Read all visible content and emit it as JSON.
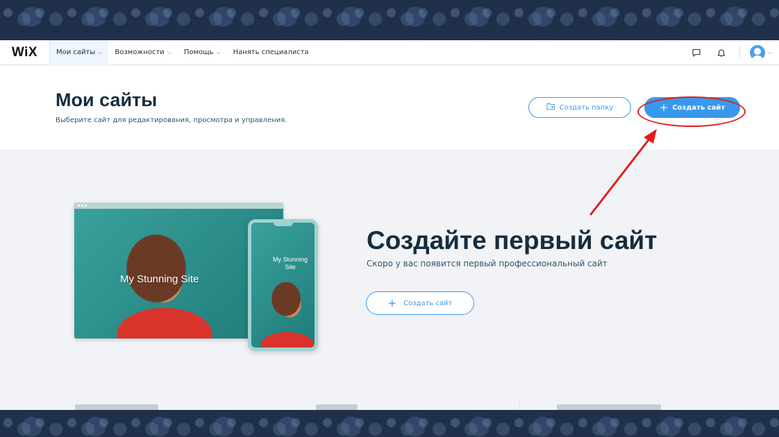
{
  "nav": {
    "logo": "WiX",
    "items": [
      {
        "label": "Мои сайты",
        "chevron": true,
        "active": true
      },
      {
        "label": "Возможности",
        "chevron": true
      },
      {
        "label": "Помощь",
        "chevron": true
      },
      {
        "label": "Нанять специалиста",
        "chevron": false
      }
    ],
    "icons": [
      "chat-icon",
      "bell-icon",
      "avatar",
      "chevron-down-icon"
    ]
  },
  "header": {
    "title": "Мои сайты",
    "subtitle": "Выберите сайт для редактирования, просмотра и управления.",
    "folder_button": "Создать папку",
    "create_button": "Создать сайт",
    "create_icon": "+"
  },
  "hero": {
    "mock_site_title": "My Stunning Site",
    "phone_title": "My Stunning Site",
    "title": "Создайте первый сайт",
    "subtitle": "Скоро у вас появится первый профессиональный сайт",
    "button": "Создать сайт",
    "button_icon": "+"
  },
  "colors": {
    "accent": "#3899ec",
    "text_dark": "#162d3d",
    "annotation_red": "#e31d1d",
    "background": "#f1f3f6"
  }
}
